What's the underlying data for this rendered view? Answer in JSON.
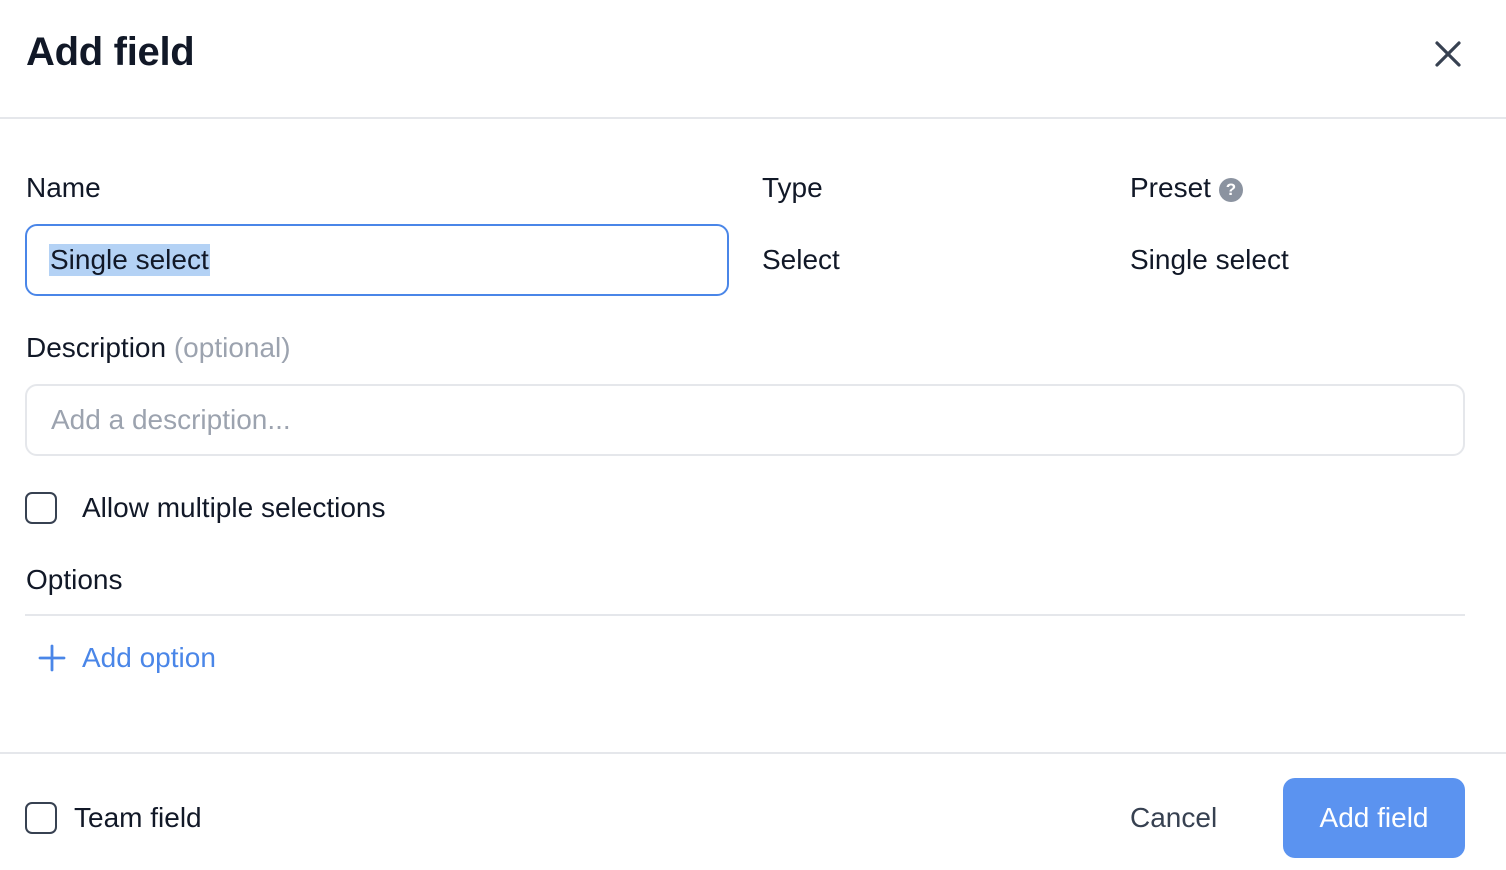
{
  "dialog": {
    "title": "Add field",
    "close_icon": "close-icon"
  },
  "form": {
    "name": {
      "label": "Name",
      "value": "Single select"
    },
    "type": {
      "label": "Type",
      "value": "Select"
    },
    "preset": {
      "label": "Preset",
      "help_icon": "question-circle-icon",
      "help_glyph": "?",
      "value": "Single select"
    },
    "description": {
      "label": "Description",
      "optional_hint": "(optional)",
      "placeholder": "Add a description..."
    },
    "allow_multiple": {
      "label": "Allow multiple selections",
      "checked": false
    },
    "options": {
      "label": "Options",
      "add_option_label": "Add option",
      "add_icon": "plus-icon"
    }
  },
  "footer": {
    "team_field": {
      "label": "Team field",
      "checked": false
    },
    "cancel_label": "Cancel",
    "submit_label": "Add field"
  },
  "colors": {
    "accent": "#4a86e8",
    "primary_button": "#5b93f0",
    "selection_highlight": "#b4d2f5",
    "border": "#e5e7eb",
    "muted_text": "#9ca3af"
  }
}
